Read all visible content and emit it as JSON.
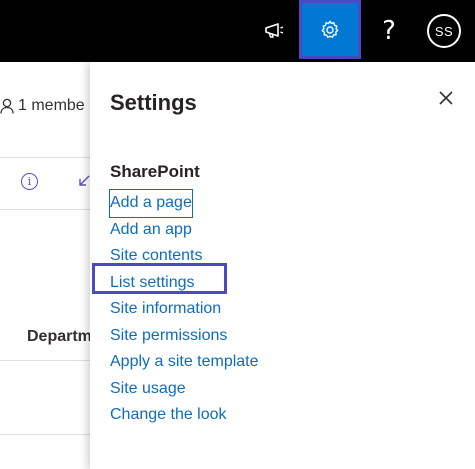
{
  "topbar": {
    "icons": [
      "megaphone-icon",
      "gear-icon",
      "help-icon"
    ],
    "help_glyph": "?",
    "avatar_initials": "SS"
  },
  "background_page": {
    "members_label": "1 membe",
    "column_header": "Departm"
  },
  "settings_panel": {
    "title": "Settings",
    "section_title": "SharePoint",
    "links": [
      "Add a page",
      "Add an app",
      "Site contents",
      "List settings",
      "Site information",
      "Site permissions",
      "Apply a site template",
      "Site usage",
      "Change the look"
    ]
  },
  "colors": {
    "topbar_bg": "#000000",
    "gear_active_bg": "#0078d4",
    "highlight_border": "#4b49c4",
    "link": "#0f6cbd"
  }
}
